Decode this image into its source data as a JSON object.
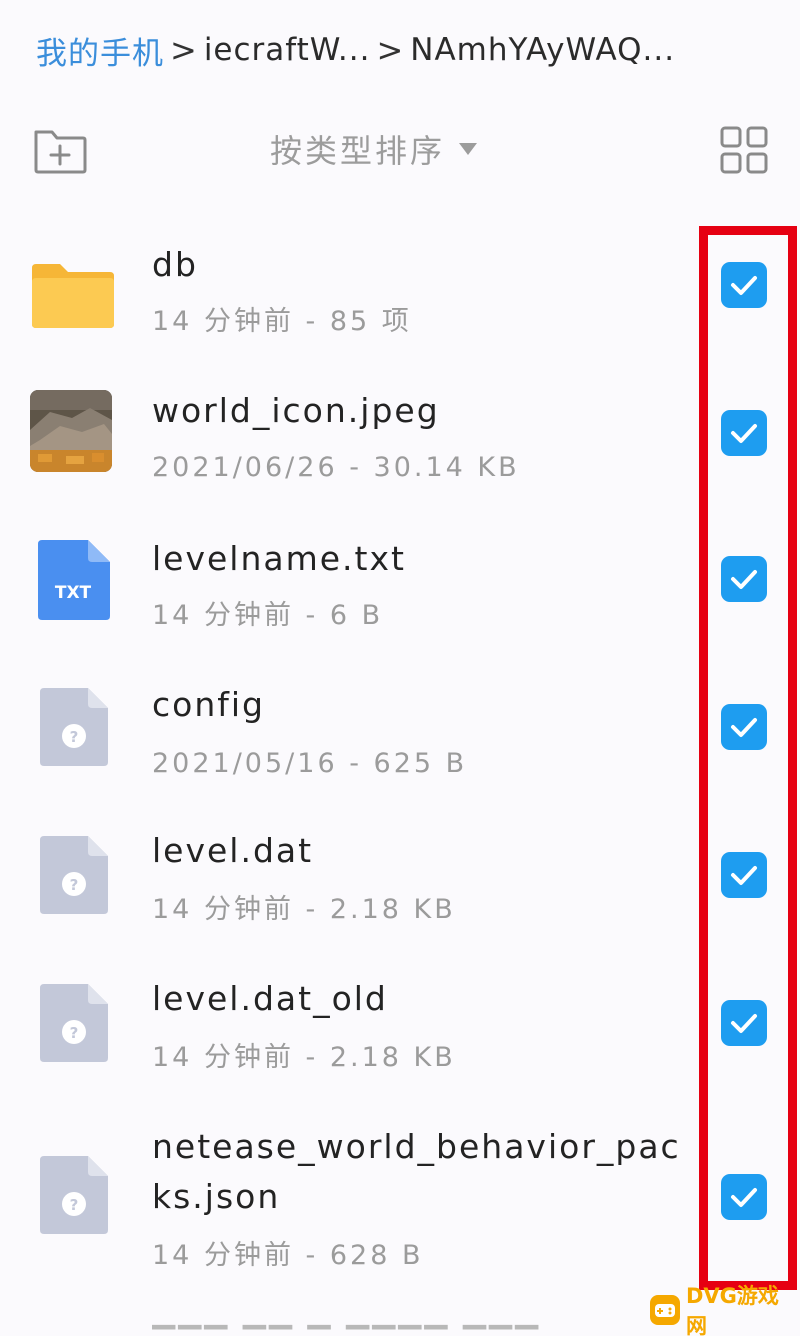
{
  "breadcrumb": {
    "items": [
      "我的手机",
      "iecraftW...",
      "NAmhYAyWAQ..."
    ],
    "separator": ">"
  },
  "toolbar": {
    "sort_label": "按类型排序",
    "new_folder_icon": "folder-plus-icon",
    "view_toggle_icon": "grid-view-icon"
  },
  "files": [
    {
      "name": "db",
      "meta": "14 分钟前 - 85 项",
      "type": "folder",
      "checked": true
    },
    {
      "name": "world_icon.jpeg",
      "meta": "2021/06/26 - 30.14 KB",
      "type": "image",
      "checked": true
    },
    {
      "name": "levelname.txt",
      "meta": "14 分钟前 - 6 B",
      "type": "txt",
      "icon_label": "TXT",
      "checked": true
    },
    {
      "name": "config",
      "meta": "2021/05/16 - 625 B",
      "type": "unknown",
      "checked": true
    },
    {
      "name": "level.dat",
      "meta": "14 分钟前 - 2.18 KB",
      "type": "unknown",
      "checked": true
    },
    {
      "name": "level.dat_old",
      "meta": "14 分钟前 - 2.18 KB",
      "type": "unknown",
      "checked": true
    },
    {
      "name": "netease_world_behavior_packs.json",
      "meta": "14 分钟前 - 628 B",
      "type": "unknown",
      "checked": true
    }
  ],
  "watermark": {
    "text": "DVG游戏网"
  },
  "colors": {
    "accent": "#1e9df0",
    "breadcrumb_root": "#3b8edb",
    "highlight": "#e60012",
    "folder": "#fcc94a",
    "txt_icon": "#4a8ff0",
    "unknown_icon": "#c3c8d9"
  }
}
